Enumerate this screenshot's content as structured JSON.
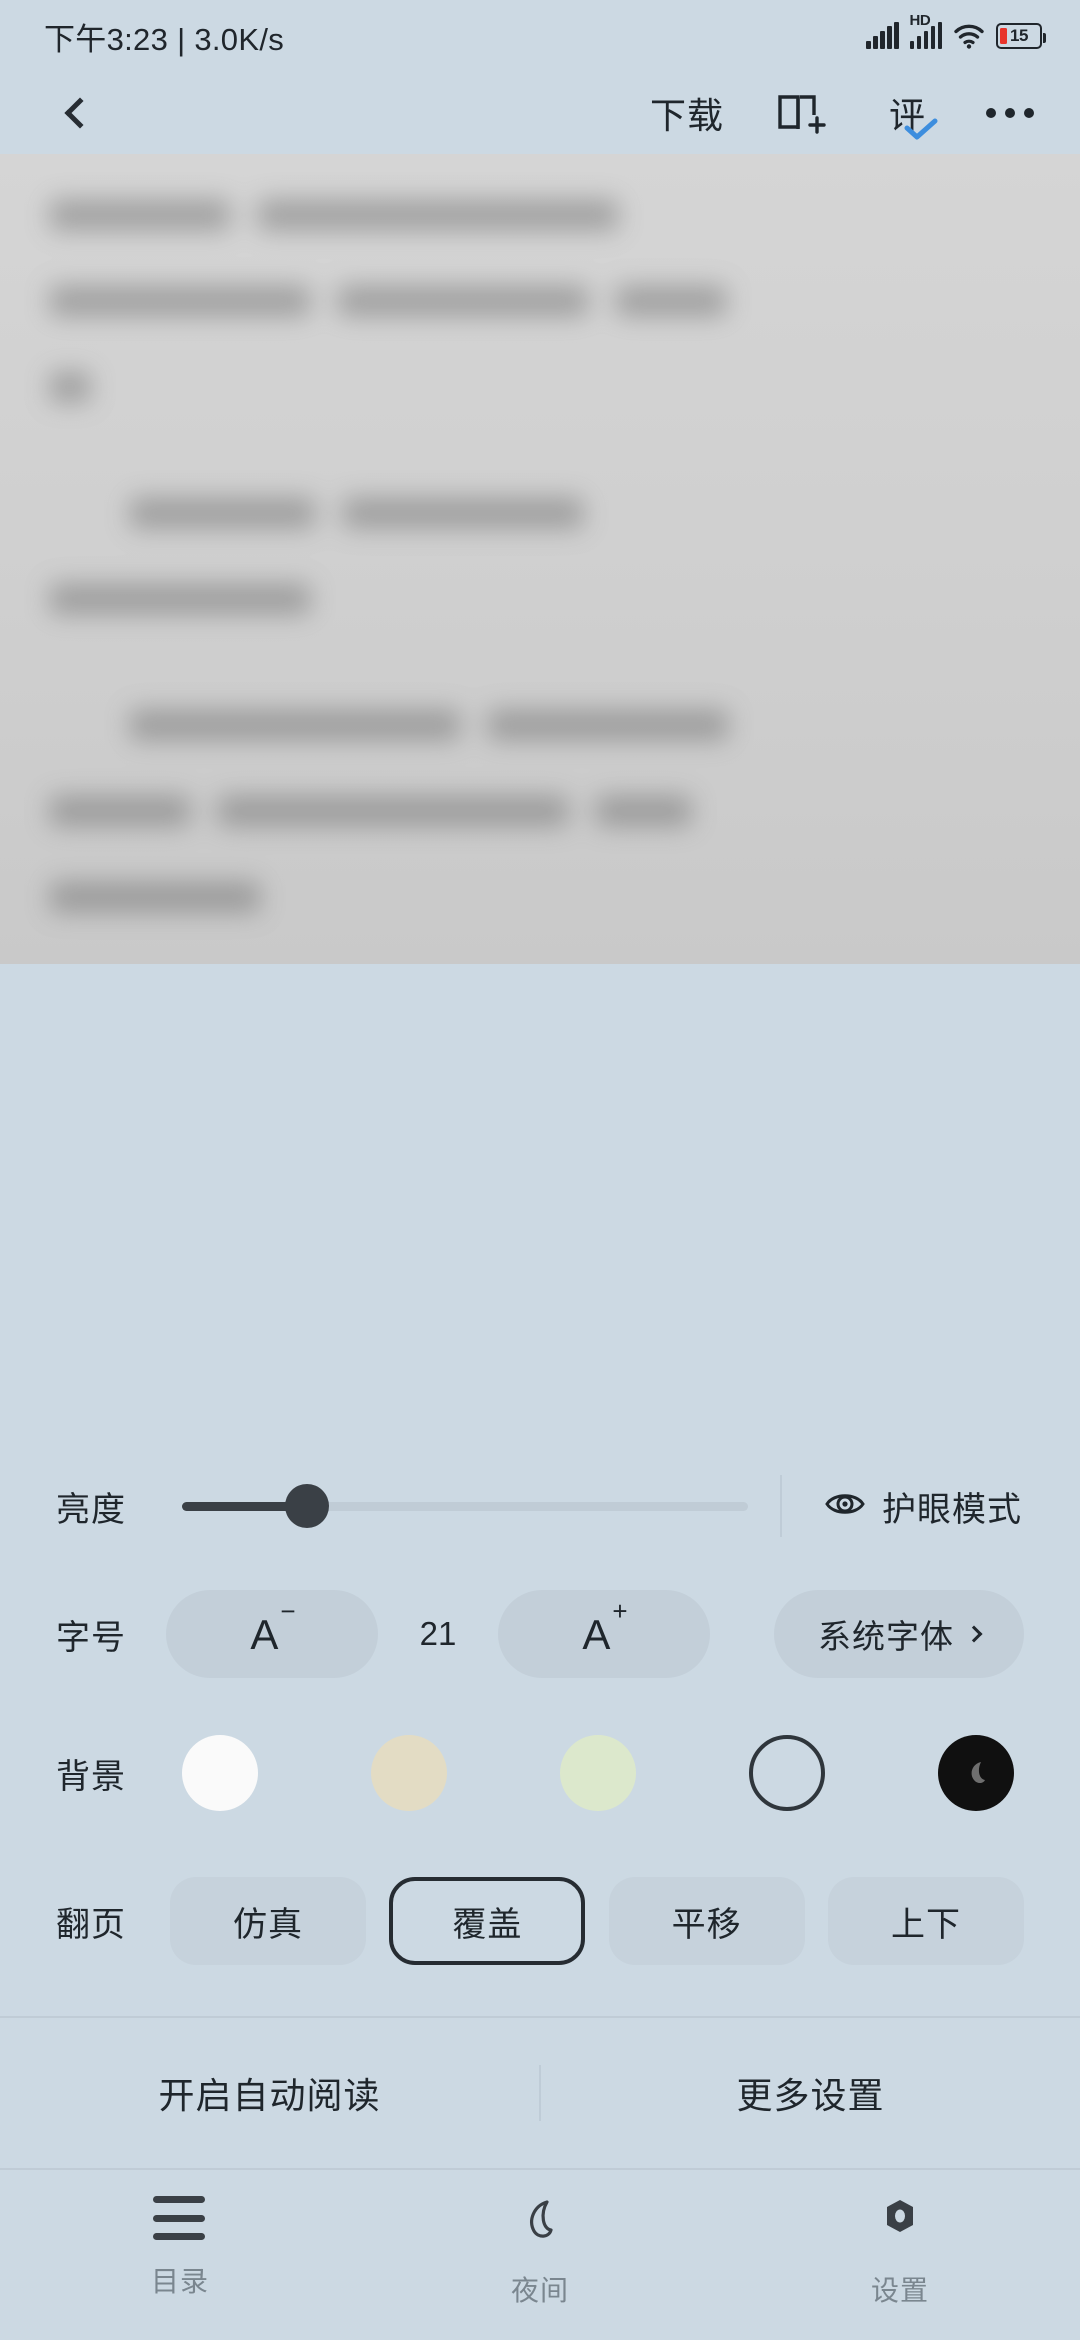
{
  "status_bar": {
    "time": "下午3:23",
    "separator": "|",
    "network_speed": "3.0K/s",
    "hd_label": "HD",
    "battery_percent": "15",
    "icons": [
      "signal-bars-icon",
      "signal-bars-hd-icon",
      "wifi-icon",
      "battery-icon"
    ]
  },
  "top_nav": {
    "back_icon": "chevron-left-icon",
    "download_label": "下载",
    "bookshelf_icon": "book-add-icon",
    "review_label": "评",
    "review_check_icon": "check-icon",
    "review_check_color": "#3d8ede",
    "more_icon": "more-dots-icon"
  },
  "settings_panel": {
    "brightness": {
      "label": "亮度",
      "value_percent": 22,
      "eyecare_label": "护眼模式",
      "eyecare_icon": "eye-icon"
    },
    "font_size": {
      "label": "字号",
      "decrease_label": "A",
      "decrease_sup": "−",
      "value": "21",
      "increase_label": "A",
      "increase_sup": "+",
      "font_family_label": "系统字体",
      "font_family_chevron": "chevron-right-icon"
    },
    "background": {
      "label": "背景",
      "swatches": [
        {
          "name": "white",
          "color": "#fafafa",
          "selected": false,
          "style": "fill"
        },
        {
          "name": "beige",
          "color": "#e3dcc4",
          "selected": false,
          "style": "fill"
        },
        {
          "name": "green",
          "color": "#dce8cc",
          "selected": false,
          "style": "fill"
        },
        {
          "name": "outline",
          "color": "transparent",
          "selected": false,
          "style": "outline"
        },
        {
          "name": "dark",
          "color": "#101010",
          "selected": false,
          "style": "moon"
        }
      ]
    },
    "page_turn": {
      "label": "翻页",
      "options": [
        {
          "label": "仿真",
          "selected": false
        },
        {
          "label": "覆盖",
          "selected": true
        },
        {
          "label": "平移",
          "selected": false
        },
        {
          "label": "上下",
          "selected": false
        }
      ]
    },
    "actions": {
      "auto_read_label": "开启自动阅读",
      "more_settings_label": "更多设置"
    }
  },
  "tab_bar": {
    "tabs": [
      {
        "label": "目录",
        "icon": "hamburger-icon"
      },
      {
        "label": "夜间",
        "icon": "moon-icon"
      },
      {
        "label": "设置",
        "icon": "gear-icon"
      }
    ]
  },
  "theme": {
    "panel_bg": "#ccd9e3",
    "text_primary": "#1f262c",
    "pill_bg": "#c3cfd9",
    "accent_blue": "#3d8ede",
    "battery_red": "#e8342b"
  }
}
